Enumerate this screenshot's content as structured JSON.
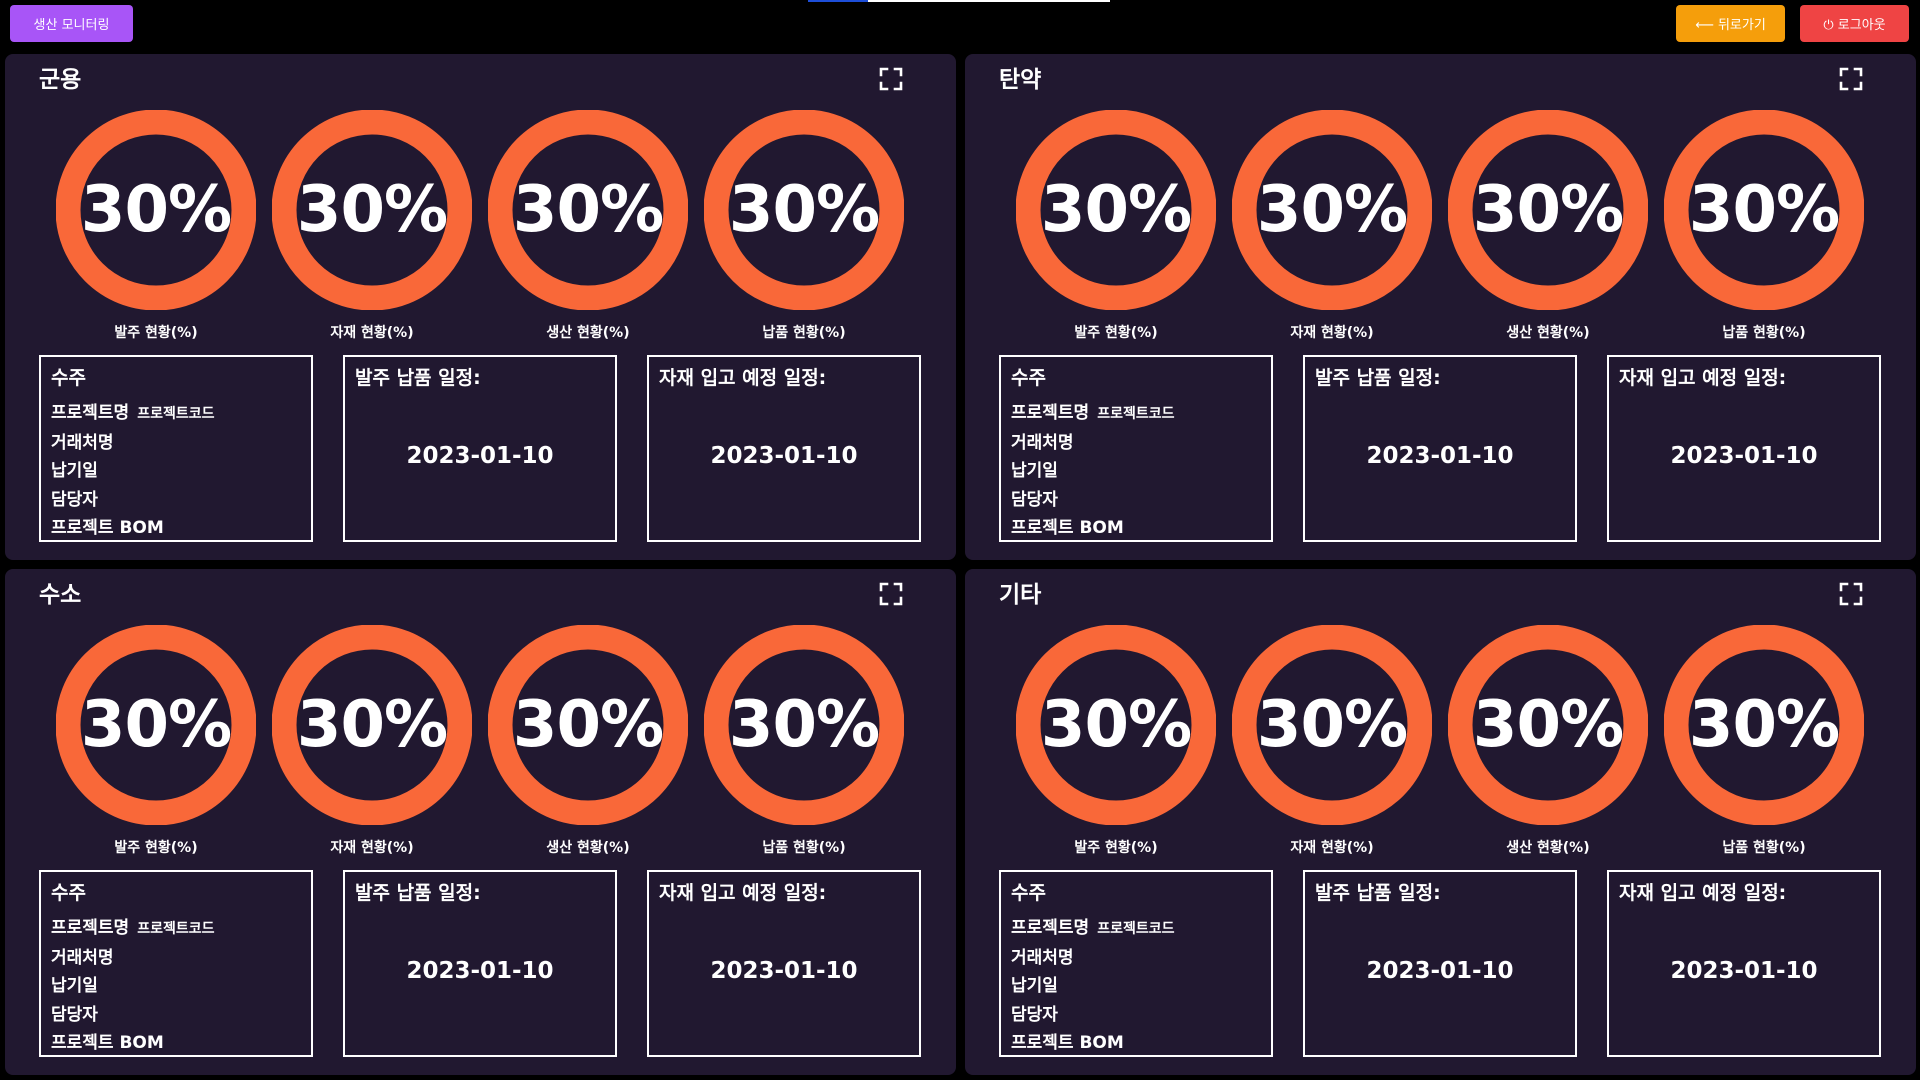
{
  "header": {
    "monitor_label": "생산 모니터링",
    "back_label": "⟵ 뒤로가기",
    "logout_label": "⏻ 로그아웃"
  },
  "panels": [
    {
      "title": "군용",
      "gauges": [
        {
          "value": "30%",
          "label": "발주 현황(%)"
        },
        {
          "value": "30%",
          "label": "자재 현황(%)"
        },
        {
          "value": "30%",
          "label": "생산 현황(%)"
        },
        {
          "value": "30%",
          "label": "납품 현황(%)"
        }
      ],
      "order": {
        "title": "수주",
        "project_name": "프로젝트명",
        "project_code": "프로젝트코드",
        "client": "거래처명",
        "due": "납기일",
        "manager": "담당자",
        "bom": "프로젝트 BOM"
      },
      "delivery": {
        "title": "발주 납품 일정:",
        "date": "2023-01-10"
      },
      "material": {
        "title": "자재 입고 예정 일정:",
        "date": "2023-01-10"
      }
    },
    {
      "title": "탄약",
      "gauges": [
        {
          "value": "30%",
          "label": "발주 현황(%)"
        },
        {
          "value": "30%",
          "label": "자재 현황(%)"
        },
        {
          "value": "30%",
          "label": "생산 현황(%)"
        },
        {
          "value": "30%",
          "label": "납품 현황(%)"
        }
      ],
      "order": {
        "title": "수주",
        "project_name": "프로젝트명",
        "project_code": "프로젝트코드",
        "client": "거래처명",
        "due": "납기일",
        "manager": "담당자",
        "bom": "프로젝트 BOM"
      },
      "delivery": {
        "title": "발주 납품 일정:",
        "date": "2023-01-10"
      },
      "material": {
        "title": "자재 입고 예정 일정:",
        "date": "2023-01-10"
      }
    },
    {
      "title": "수소",
      "gauges": [
        {
          "value": "30%",
          "label": "발주 현황(%)"
        },
        {
          "value": "30%",
          "label": "자재 현황(%)"
        },
        {
          "value": "30%",
          "label": "생산 현황(%)"
        },
        {
          "value": "30%",
          "label": "납품 현황(%)"
        }
      ],
      "order": {
        "title": "수주",
        "project_name": "프로젝트명",
        "project_code": "프로젝트코드",
        "client": "거래처명",
        "due": "납기일",
        "manager": "담당자",
        "bom": "프로젝트 BOM"
      },
      "delivery": {
        "title": "발주 납품 일정:",
        "date": "2023-01-10"
      },
      "material": {
        "title": "자재 입고 예정 일정:",
        "date": "2023-01-10"
      }
    },
    {
      "title": "기타",
      "gauges": [
        {
          "value": "30%",
          "label": "발주 현황(%)"
        },
        {
          "value": "30%",
          "label": "자재 현황(%)"
        },
        {
          "value": "30%",
          "label": "생산 현황(%)"
        },
        {
          "value": "30%",
          "label": "납품 현황(%)"
        }
      ],
      "order": {
        "title": "수주",
        "project_name": "프로젝트명",
        "project_code": "프로젝트코드",
        "client": "거래처명",
        "due": "납기일",
        "manager": "담당자",
        "bom": "프로젝트 BOM"
      },
      "delivery": {
        "title": "발주 납품 일정:",
        "date": "2023-01-10"
      },
      "material": {
        "title": "자재 입고 예정 일정:",
        "date": "2023-01-10"
      }
    }
  ],
  "colors": {
    "gauge": "#f96839",
    "panel_bg": "#211830",
    "monitor_button": "#a855f7",
    "back_button": "#f59e0b",
    "logout_button": "#ef4444"
  }
}
